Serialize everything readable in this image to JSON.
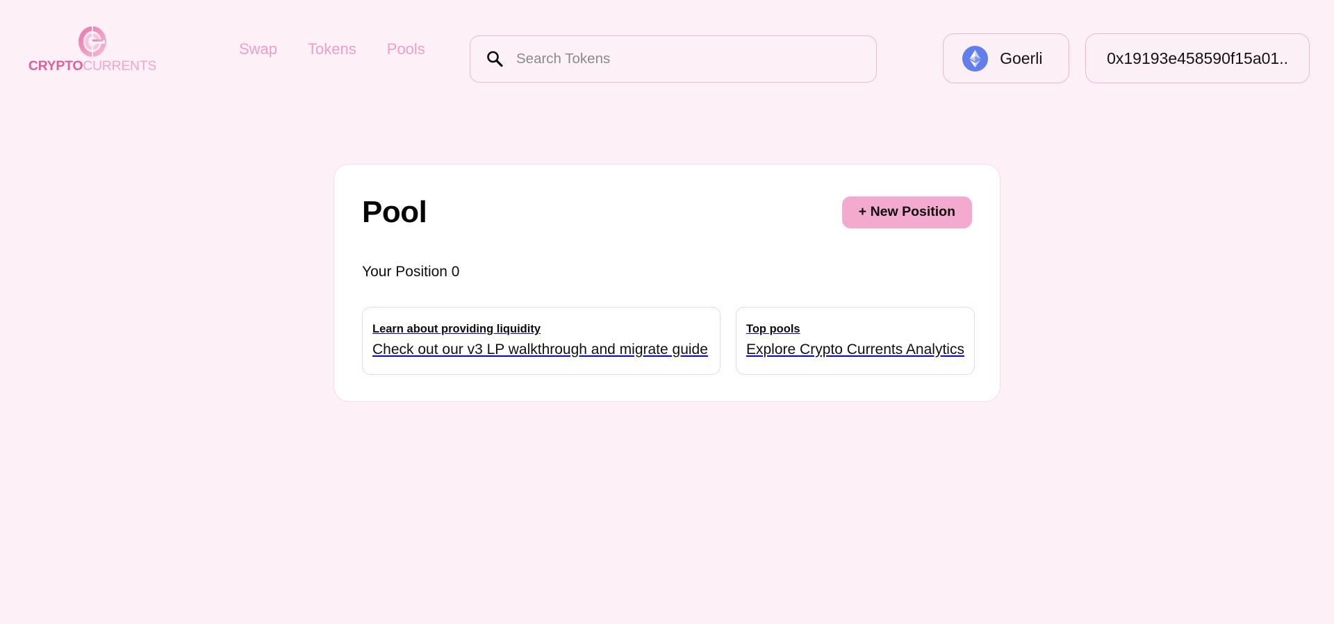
{
  "brand": {
    "word_primary": "CRYPTO",
    "word_secondary": "CURRENTS",
    "mark_icon": "crypto-currents-logo-mark",
    "colors": {
      "primary": "#e0609d",
      "secondary": "#f3a6c8"
    }
  },
  "nav": {
    "items": [
      {
        "label": "Swap"
      },
      {
        "label": "Tokens"
      },
      {
        "label": "Pools"
      }
    ]
  },
  "search": {
    "icon": "search-icon",
    "placeholder": "Search Tokens",
    "value": ""
  },
  "wallet": {
    "network": {
      "label": "Goerli",
      "icon": "ethereum-icon",
      "icon_color": "#627eea"
    },
    "address": "0x19193e458590f15a01.."
  },
  "pool": {
    "title": "Pool",
    "new_position_label": "+ New Position",
    "your_position_label": "Your Position 0",
    "accent_color": "#f4a9ce",
    "info_cards": [
      {
        "title": "Learn about providing liquidity",
        "subtitle": "Check out our v3 LP walkthrough and migrate guide"
      },
      {
        "title": "Top pools",
        "subtitle": "Explore Crypto Currents Analytics"
      }
    ]
  },
  "theme": {
    "page_background": "#fdf1f7",
    "card_background": "#ffffff",
    "border_pink": "#f2b4d2"
  }
}
